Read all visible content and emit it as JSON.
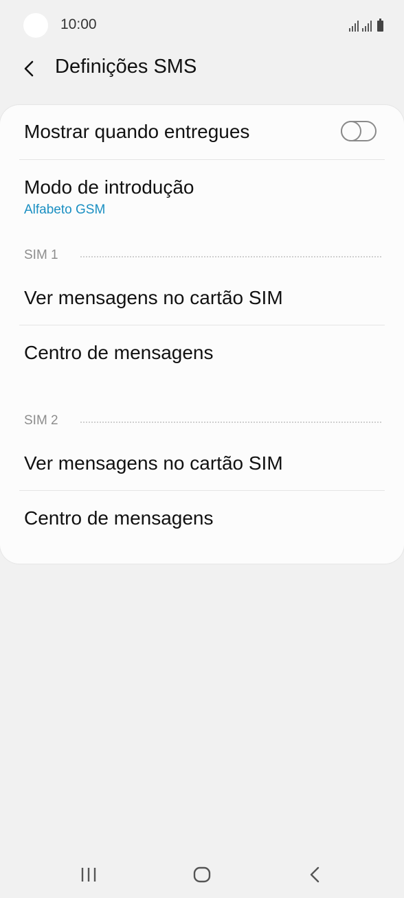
{
  "status_bar": {
    "time": "10:00",
    "icons": [
      "signal-sim1-icon",
      "signal-sim2-icon",
      "battery-icon"
    ]
  },
  "header": {
    "back_icon": "chevron-left-icon",
    "title": "Definições SMS"
  },
  "settings": {
    "delivery": {
      "label": "Mostrar quando entregues",
      "toggle_on": false
    },
    "input_mode": {
      "label": "Modo de introdução",
      "value": "Alfabeto GSM"
    },
    "sim1": {
      "header": "SIM 1",
      "view_messages": "Ver mensagens no cartão SIM",
      "message_center": "Centro de mensagens"
    },
    "sim2": {
      "header": "SIM 2",
      "view_messages": "Ver mensagens no cartão SIM",
      "message_center": "Centro de mensagens"
    }
  },
  "colors": {
    "background": "#f1f1f1",
    "card": "#fcfcfc",
    "accent": "#1a8fc2",
    "section_label": "#8d8d8d"
  },
  "nav_bar": {
    "icons": [
      "recent-apps-icon",
      "home-icon",
      "back-icon"
    ]
  }
}
